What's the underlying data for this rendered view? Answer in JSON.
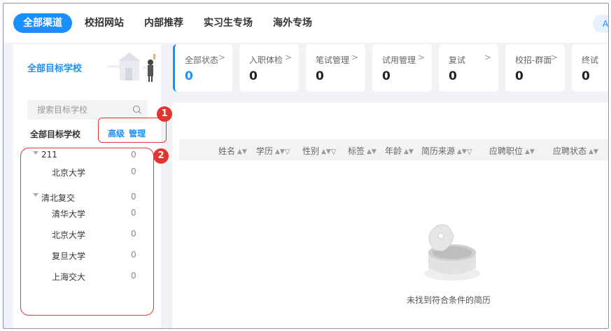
{
  "nav": {
    "tabs": [
      {
        "label": "全部渠道",
        "active": true
      },
      {
        "label": "校招网站"
      },
      {
        "label": "内部推荐"
      },
      {
        "label": "实习生专场"
      },
      {
        "label": "海外专场"
      }
    ],
    "avatar_text": "A"
  },
  "sidebar": {
    "title": "全部目标学校",
    "search_placeholder": "搜索目标学校",
    "all_label": "全部目标学校",
    "advanced_label": "高级",
    "manage_label": "管理",
    "tree": [
      {
        "label": "211",
        "count": "0",
        "type": "group"
      },
      {
        "label": "北京大学",
        "count": "0",
        "type": "leaf"
      },
      {
        "label": "清北复交",
        "count": "0",
        "type": "group"
      },
      {
        "label": "清华大学",
        "count": "0",
        "type": "leaf"
      },
      {
        "label": "北京大学",
        "count": "0",
        "type": "leaf"
      },
      {
        "label": "复旦大学",
        "count": "0",
        "type": "leaf"
      },
      {
        "label": "上海交大",
        "count": "0",
        "type": "leaf"
      }
    ]
  },
  "annotations": {
    "badge_1": "1",
    "badge_2": "2"
  },
  "status_cards": [
    {
      "label": "全部状态",
      "value": "0",
      "active": true
    },
    {
      "label": "入职体检",
      "value": "0"
    },
    {
      "label": "笔试管理",
      "value": "0"
    },
    {
      "label": "试用管理",
      "value": "0"
    },
    {
      "label": "复试",
      "value": "0"
    },
    {
      "label": "校招-群面",
      "value": "0"
    },
    {
      "label": "终试",
      "value": "0"
    }
  ],
  "table": {
    "columns": [
      {
        "label": "姓名",
        "sort": true,
        "filter": false
      },
      {
        "label": "学历",
        "sort": true,
        "filter": true
      },
      {
        "label": "性别",
        "sort": true,
        "filter": true
      },
      {
        "label": "标签",
        "sort": true,
        "filter": false
      },
      {
        "label": "年龄",
        "sort": true,
        "filter": false
      },
      {
        "label": "简历来源",
        "sort": true,
        "filter": true
      },
      {
        "label": "应聘职位",
        "sort": true,
        "filter": false
      },
      {
        "label": "应聘状态",
        "sort": true,
        "filter": false
      }
    ],
    "empty_text": "未找到符合条件的简历"
  },
  "colors": {
    "accent": "#1890ff",
    "annotation": "#e3342f"
  }
}
